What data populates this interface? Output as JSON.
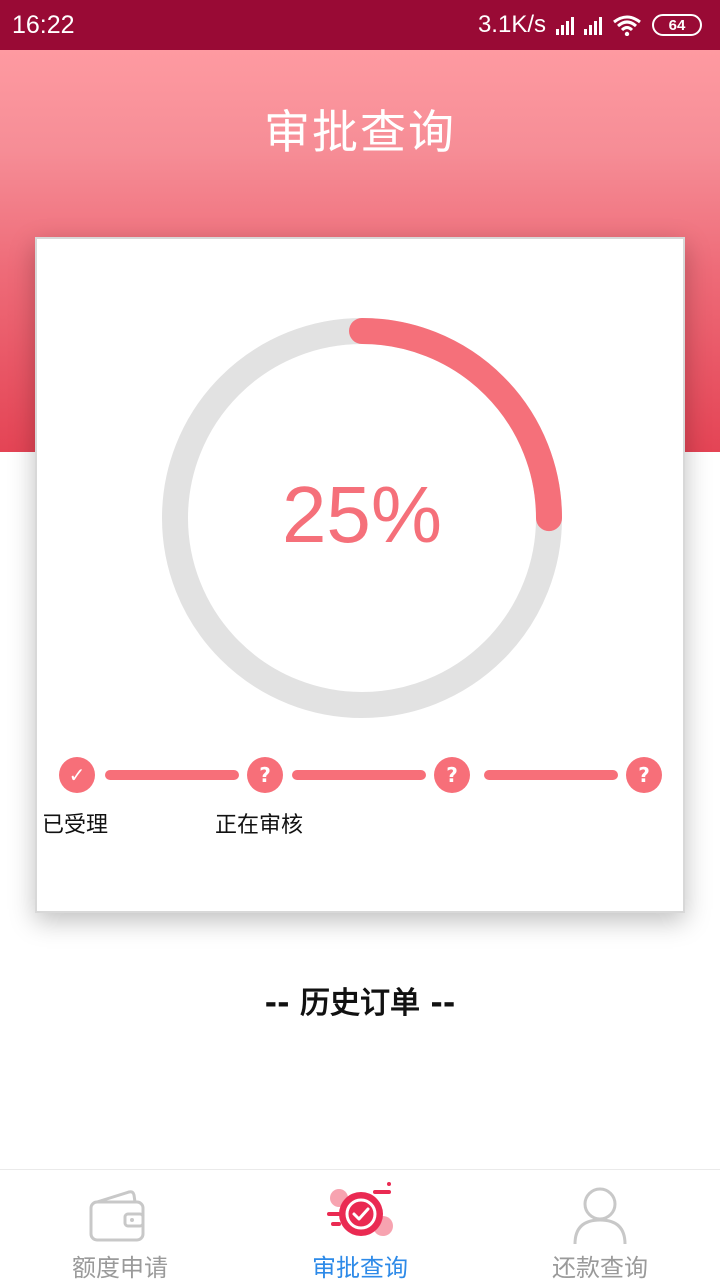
{
  "status_bar": {
    "time": "16:22",
    "network_speed": "3.1K/s",
    "battery": "64"
  },
  "header": {
    "title": "审批查询",
    "gradient_top": "#fe9aa1",
    "gradient_bottom": "#e44455"
  },
  "progress": {
    "value_text": "25%",
    "fraction": 0.25,
    "accent_color": "#f5707a",
    "track_color": "#e2e2e2"
  },
  "steps": [
    {
      "label": "已受理",
      "icon": "check-icon"
    },
    {
      "label": "正在审核",
      "icon": "question-icon"
    },
    {
      "label": "",
      "icon": "question-icon"
    },
    {
      "label": "",
      "icon": "question-icon"
    }
  ],
  "history": {
    "title": "-- 历史订单 --"
  },
  "bottom_nav": {
    "items": [
      {
        "label": "额度申请",
        "icon": "wallet-icon",
        "active": false
      },
      {
        "label": "审批查询",
        "icon": "approval-check-icon",
        "active": true
      },
      {
        "label": "还款查询",
        "icon": "user-icon",
        "active": false
      }
    ],
    "active_color": "#2d8ae8",
    "inactive_color": "#9a9a9a"
  }
}
